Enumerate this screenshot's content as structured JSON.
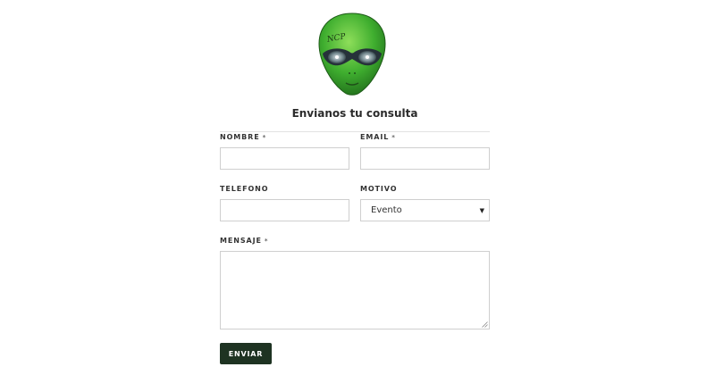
{
  "logo": {
    "text": "NCP"
  },
  "form": {
    "title": "Envianos tu consulta",
    "nombre": {
      "label": "NOMBRE",
      "required": "*",
      "value": ""
    },
    "email": {
      "label": "EMAIL",
      "required": "*",
      "value": ""
    },
    "telefono": {
      "label": "TELEFONO",
      "value": ""
    },
    "motivo": {
      "label": "MOTIVO",
      "selected": "Evento"
    },
    "mensaje": {
      "label": "MENSAJE",
      "required": "*",
      "value": ""
    },
    "submit_label": "ENVIAR"
  },
  "colors": {
    "button_bg": "#1e3322",
    "alien_green": "#3fae2f"
  },
  "icons": {
    "select_caret": "caret-down-icon",
    "resize": "resize-grip-icon"
  }
}
